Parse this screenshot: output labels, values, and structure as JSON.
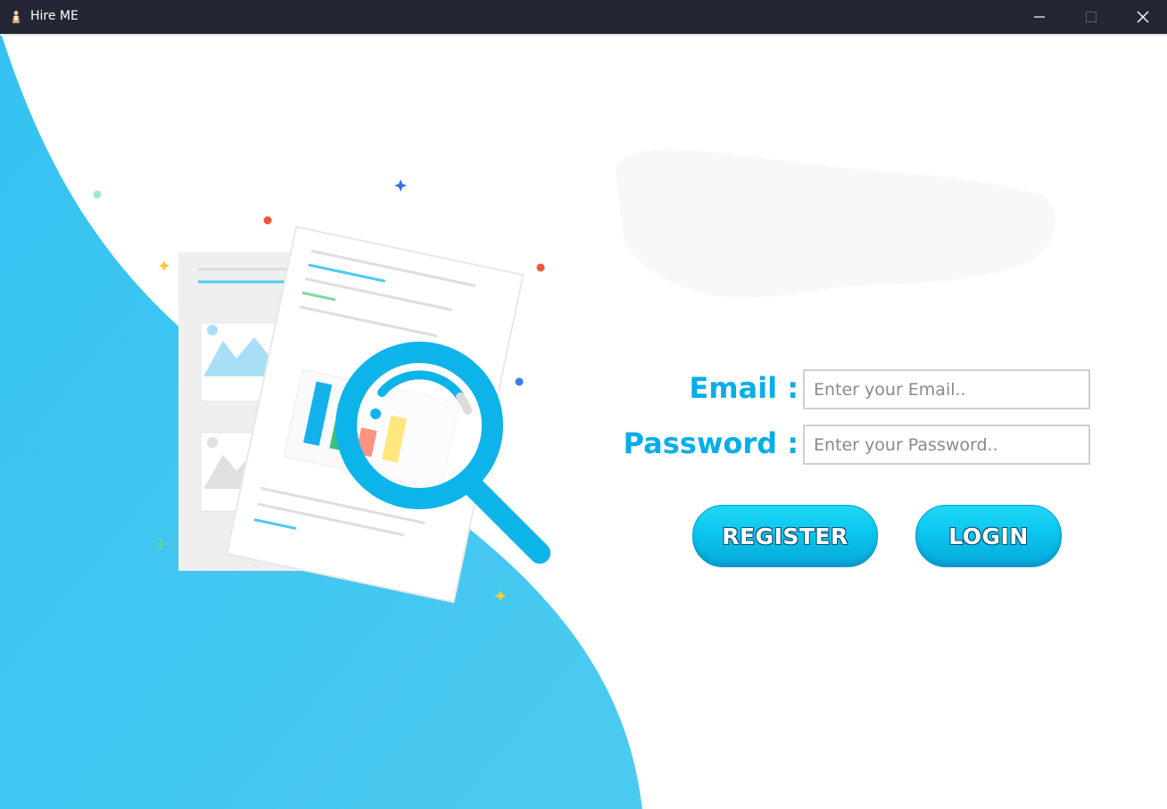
{
  "window": {
    "title": "Hire ME",
    "controls": {
      "minimize": "minimize-icon",
      "maximize": "maximize-icon",
      "close": "close-icon"
    }
  },
  "form": {
    "email_label": "Email :",
    "email_placeholder": "Enter your Email..",
    "email_value": "",
    "password_label": "Password :",
    "password_placeholder": "Enter your Password..",
    "password_value": ""
  },
  "buttons": {
    "register_label": "REGISTER",
    "login_label": "LOGIN"
  },
  "colors": {
    "titlebar": "#252635",
    "accent": "#05aee8",
    "wave": "#40c6ef",
    "button_top": "#1fd8f7",
    "button_bottom": "#07a8d8"
  }
}
